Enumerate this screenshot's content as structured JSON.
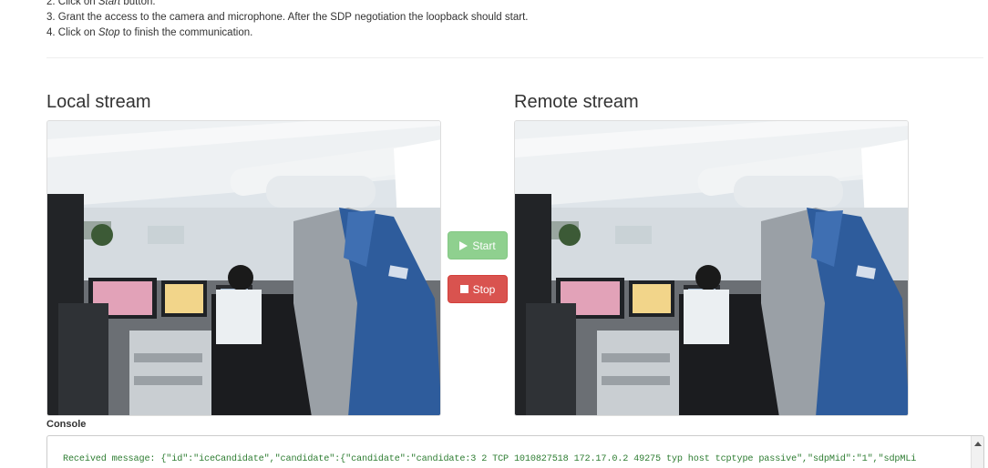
{
  "instructions": {
    "step2_prefix": "2. Click on ",
    "step2_em": "Start",
    "step2_suffix": " button.",
    "step3": "3. Grant the access to the camera and microphone. After the SDP negotiation the loopback should start.",
    "step4_prefix": "4. Click on ",
    "step4_em": "Stop",
    "step4_suffix": " to finish the communication."
  },
  "local": {
    "title": "Local stream"
  },
  "remote": {
    "title": "Remote stream"
  },
  "controls": {
    "start_label": "Start",
    "stop_label": "Stop",
    "start_icon": "play-icon",
    "stop_icon": "stop-icon",
    "start_color": "#8fd08f",
    "stop_color": "#d9534f"
  },
  "console": {
    "label": "Console",
    "line": "Received message: {\"id\":\"iceCandidate\",\"candidate\":{\"candidate\":\"candidate:3 2 TCP 1010827518 172.17.0.2 49275 typ host tcptype passive\",\"sdpMid\":\"1\",\"sdpMLi",
    "text_color": "#2e7d32"
  }
}
